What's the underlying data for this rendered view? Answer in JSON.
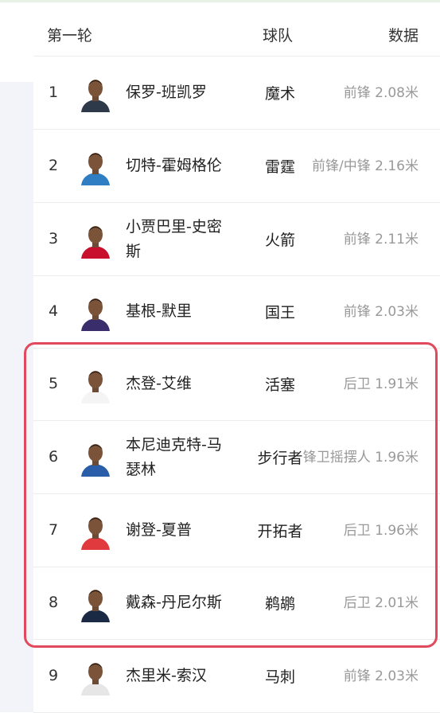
{
  "header": {
    "round": "第一轮",
    "team": "球队",
    "data": "数据"
  },
  "rows": [
    {
      "rank": "1",
      "name": "保罗-班凯罗",
      "team": "魔术",
      "stat": "前锋 2.08米",
      "jersey": "#2e3a4a"
    },
    {
      "rank": "2",
      "name": "切特-霍姆格伦",
      "team": "雷霆",
      "stat": "前锋/中锋 2.16米",
      "jersey": "#2f7ec4"
    },
    {
      "rank": "3",
      "name": "小贾巴里-史密斯",
      "team": "火箭",
      "stat": "前锋 2.11米",
      "jersey": "#c8102e"
    },
    {
      "rank": "4",
      "name": "基根-默里",
      "team": "国王",
      "stat": "前锋 2.03米",
      "jersey": "#3a2d6b"
    },
    {
      "rank": "5",
      "name": "杰登-艾维",
      "team": "活塞",
      "stat": "后卫 1.91米",
      "jersey": "#f4f4f4"
    },
    {
      "rank": "6",
      "name": "本尼迪克特-马瑟林",
      "team": "步行者",
      "stat": "锋卫摇摆人 1.96米",
      "jersey": "#2b5ea8"
    },
    {
      "rank": "7",
      "name": "谢登-夏普",
      "team": "开拓者",
      "stat": "后卫 1.96米",
      "jersey": "#e03a3e"
    },
    {
      "rank": "8",
      "name": "戴森-丹尼尔斯",
      "team": "鹈鹕",
      "stat": "后卫 2.01米",
      "jersey": "#1b2a44"
    },
    {
      "rank": "9",
      "name": "杰里米-索汉",
      "team": "马刺",
      "stat": "前锋 2.03米",
      "jersey": "#e6e6e6"
    }
  ],
  "colors": {
    "highlight": "#e04a5c",
    "stat_text": "#999999",
    "side_panel": "#f3f4f9"
  }
}
